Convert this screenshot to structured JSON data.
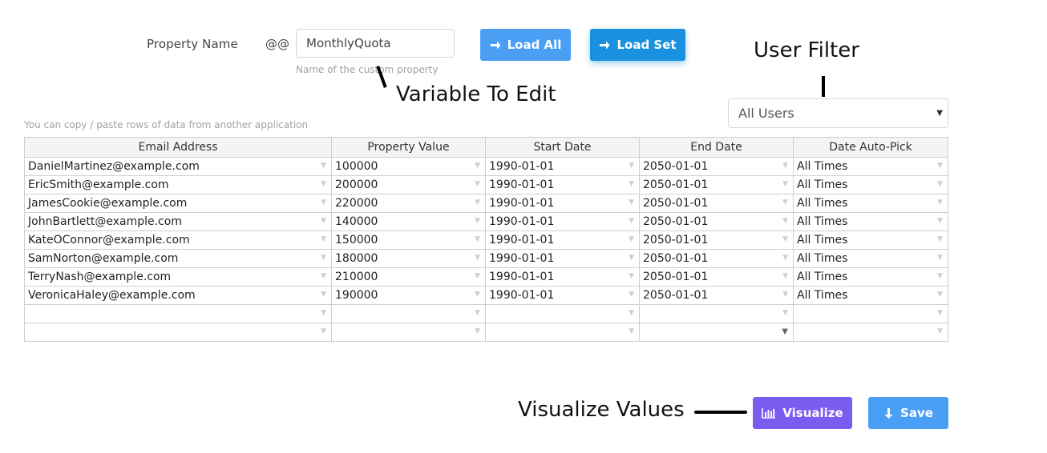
{
  "property": {
    "label": "Property Name",
    "prefix": "@@",
    "value": "MonthlyQuota",
    "help": "Name of the custom property"
  },
  "buttons": {
    "load_all": "Load All",
    "load_set": "Load Set",
    "visualize": "Visualize",
    "save": "Save"
  },
  "annotations": {
    "user_filter": "User Filter",
    "variable_to_edit": "Variable To Edit",
    "visualize_values": "Visualize Values"
  },
  "user_filter": {
    "selected": "All Users"
  },
  "copy_hint": "You can copy / paste rows of data from another application",
  "grid": {
    "headers": [
      "Email Address",
      "Property Value",
      "Start Date",
      "End Date",
      "Date Auto-Pick"
    ],
    "rows": [
      [
        "DanielMartinez@example.com",
        "100000",
        "1990-01-01",
        "2050-01-01",
        "All Times"
      ],
      [
        "EricSmith@example.com",
        "200000",
        "1990-01-01",
        "2050-01-01",
        "All Times"
      ],
      [
        "JamesCookie@example.com",
        "220000",
        "1990-01-01",
        "2050-01-01",
        "All Times"
      ],
      [
        "JohnBartlett@example.com",
        "140000",
        "1990-01-01",
        "2050-01-01",
        "All Times"
      ],
      [
        "KateOConnor@example.com",
        "150000",
        "1990-01-01",
        "2050-01-01",
        "All Times"
      ],
      [
        "SamNorton@example.com",
        "180000",
        "1990-01-01",
        "2050-01-01",
        "All Times"
      ],
      [
        "TerryNash@example.com",
        "210000",
        "1990-01-01",
        "2050-01-01",
        "All Times"
      ],
      [
        "VeronicaHaley@example.com",
        "190000",
        "1990-01-01",
        "2050-01-01",
        "All Times"
      ],
      [
        "",
        "",
        "",
        "",
        ""
      ],
      [
        "",
        "",
        "",
        "",
        ""
      ]
    ]
  },
  "colors": {
    "primary": "#4a9ff5",
    "load_set": "#1a91e0",
    "visualize": "#7b5cf0"
  }
}
